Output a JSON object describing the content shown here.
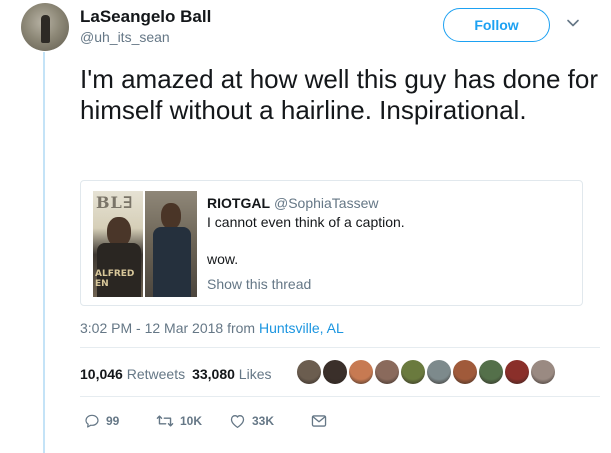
{
  "tweet": {
    "author": {
      "display_name": "LaSeangelo Ball",
      "handle": "@uh_its_sean"
    },
    "follow_label": "Follow",
    "text": "I'm amazed at how well this guy has done for himself without a hairline. Inspirational.",
    "quoted": {
      "display_name": "RIOTGAL",
      "handle": "@SophiaTassew",
      "text": "I cannot even think of a caption.",
      "text2": "wow.",
      "show_thread": "Show this thread",
      "image1_text": "BL∃",
      "image1_text2": "ALFRED EN"
    },
    "meta": {
      "time": "3:02 PM - 12 Mar 2018 from ",
      "location": "Huntsville, AL"
    },
    "stats": {
      "retweets_count": "10,046",
      "retweets_label": "Retweets",
      "likes_count": "33,080",
      "likes_label": "Likes"
    },
    "actions": {
      "reply_count": "99",
      "retweet_count": "10K",
      "like_count": "33K"
    },
    "icons": [
      "chevron-down-icon",
      "reply-icon",
      "retweet-icon",
      "like-icon",
      "message-icon"
    ],
    "colors": {
      "accent": "#1da1f2",
      "link": "#1b95e0",
      "muted": "#657786",
      "thread_line": "#c4e3f7"
    },
    "liker_colors": [
      "#6b5d4f",
      "#3a2f2a",
      "#c77a52",
      "#8a6a5c",
      "#6a7a3e",
      "#7d8a8c",
      "#a05a3a",
      "#54704a",
      "#8a2f2a",
      "#9a8a82"
    ]
  }
}
